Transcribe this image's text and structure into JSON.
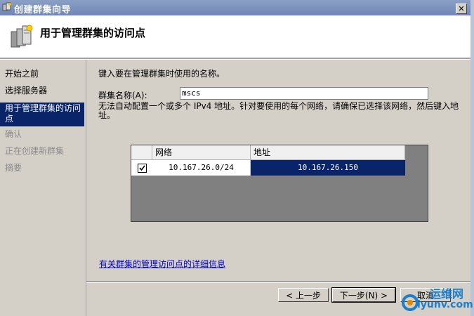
{
  "window": {
    "title": "创建群集向导",
    "close_label": "✕"
  },
  "header": {
    "title": "用于管理群集的访问点"
  },
  "sidebar": {
    "items": [
      {
        "label": "开始之前",
        "state": "normal"
      },
      {
        "label": "选择服务器",
        "state": "normal"
      },
      {
        "label": "用于管理群集的访问点",
        "state": "selected"
      },
      {
        "label": "确认",
        "state": "disabled"
      },
      {
        "label": "正在创建新群集",
        "state": "disabled"
      },
      {
        "label": "摘要",
        "state": "disabled"
      }
    ]
  },
  "main": {
    "instruction": "键入要在管理群集时使用的名称。",
    "cluster_name_label": "群集名称(A):",
    "cluster_name_value": "mscs",
    "description": "无法自动配置一个或多个 IPv4 地址。针对要使用的每个网络，请确保已选择该网络，然后键入地址。",
    "table": {
      "columns": [
        "网络",
        "地址"
      ],
      "rows": [
        {
          "checked": true,
          "network": "10.167.26.0/24",
          "address": "10.167.26.150"
        }
      ]
    },
    "more_info_link": "有关群集的管理访问点的详细信息"
  },
  "buttons": {
    "back": "< 上一步",
    "next": "下一步(N) >",
    "cancel": "取消"
  },
  "watermark": {
    "line1": "运维网",
    "line2": "iyunv.com"
  },
  "colors": {
    "titlebar": "#7b90bb",
    "selection": "#0a246a",
    "panel": "#d4d0c8",
    "link": "#0000cc"
  }
}
